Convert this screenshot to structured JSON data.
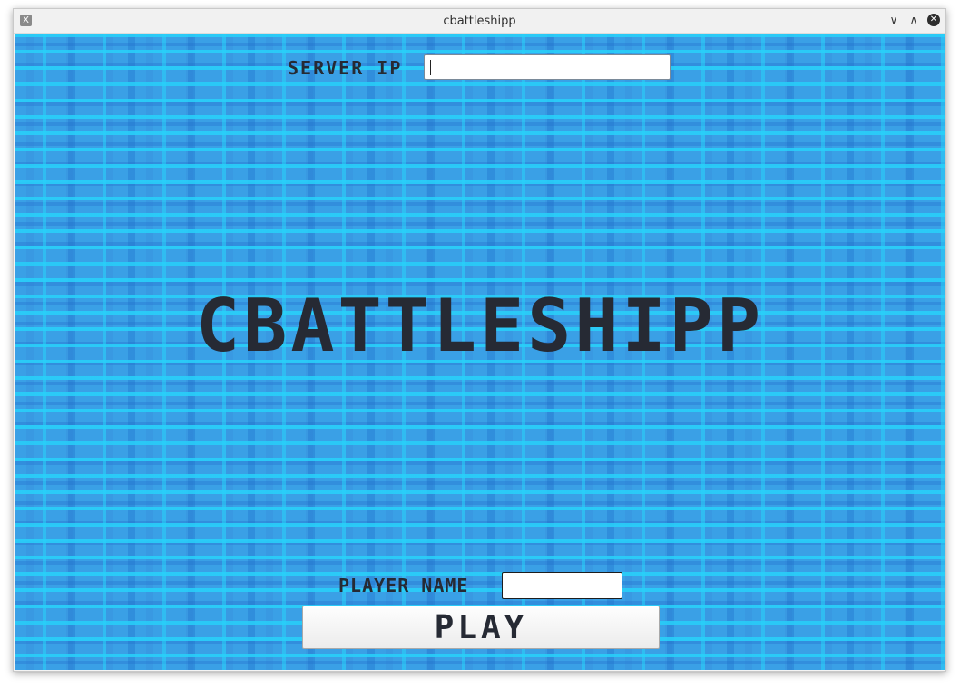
{
  "window": {
    "title": "cbattleshipp",
    "app_icon": "X",
    "controls": {
      "minimize_glyph": "∨",
      "maximize_glyph": "∧",
      "close_glyph": "✕"
    }
  },
  "server": {
    "label": "SERVER IP",
    "value": "",
    "placeholder": ""
  },
  "game_title": "CBATTLESHIPP",
  "player": {
    "label": "PLAYER NAME",
    "value": "",
    "placeholder": ""
  },
  "play_button": {
    "label": "PLAY"
  },
  "colors": {
    "water_base": "#3aa0e6",
    "water_light": "#28d2fa",
    "text": "#262a34"
  }
}
